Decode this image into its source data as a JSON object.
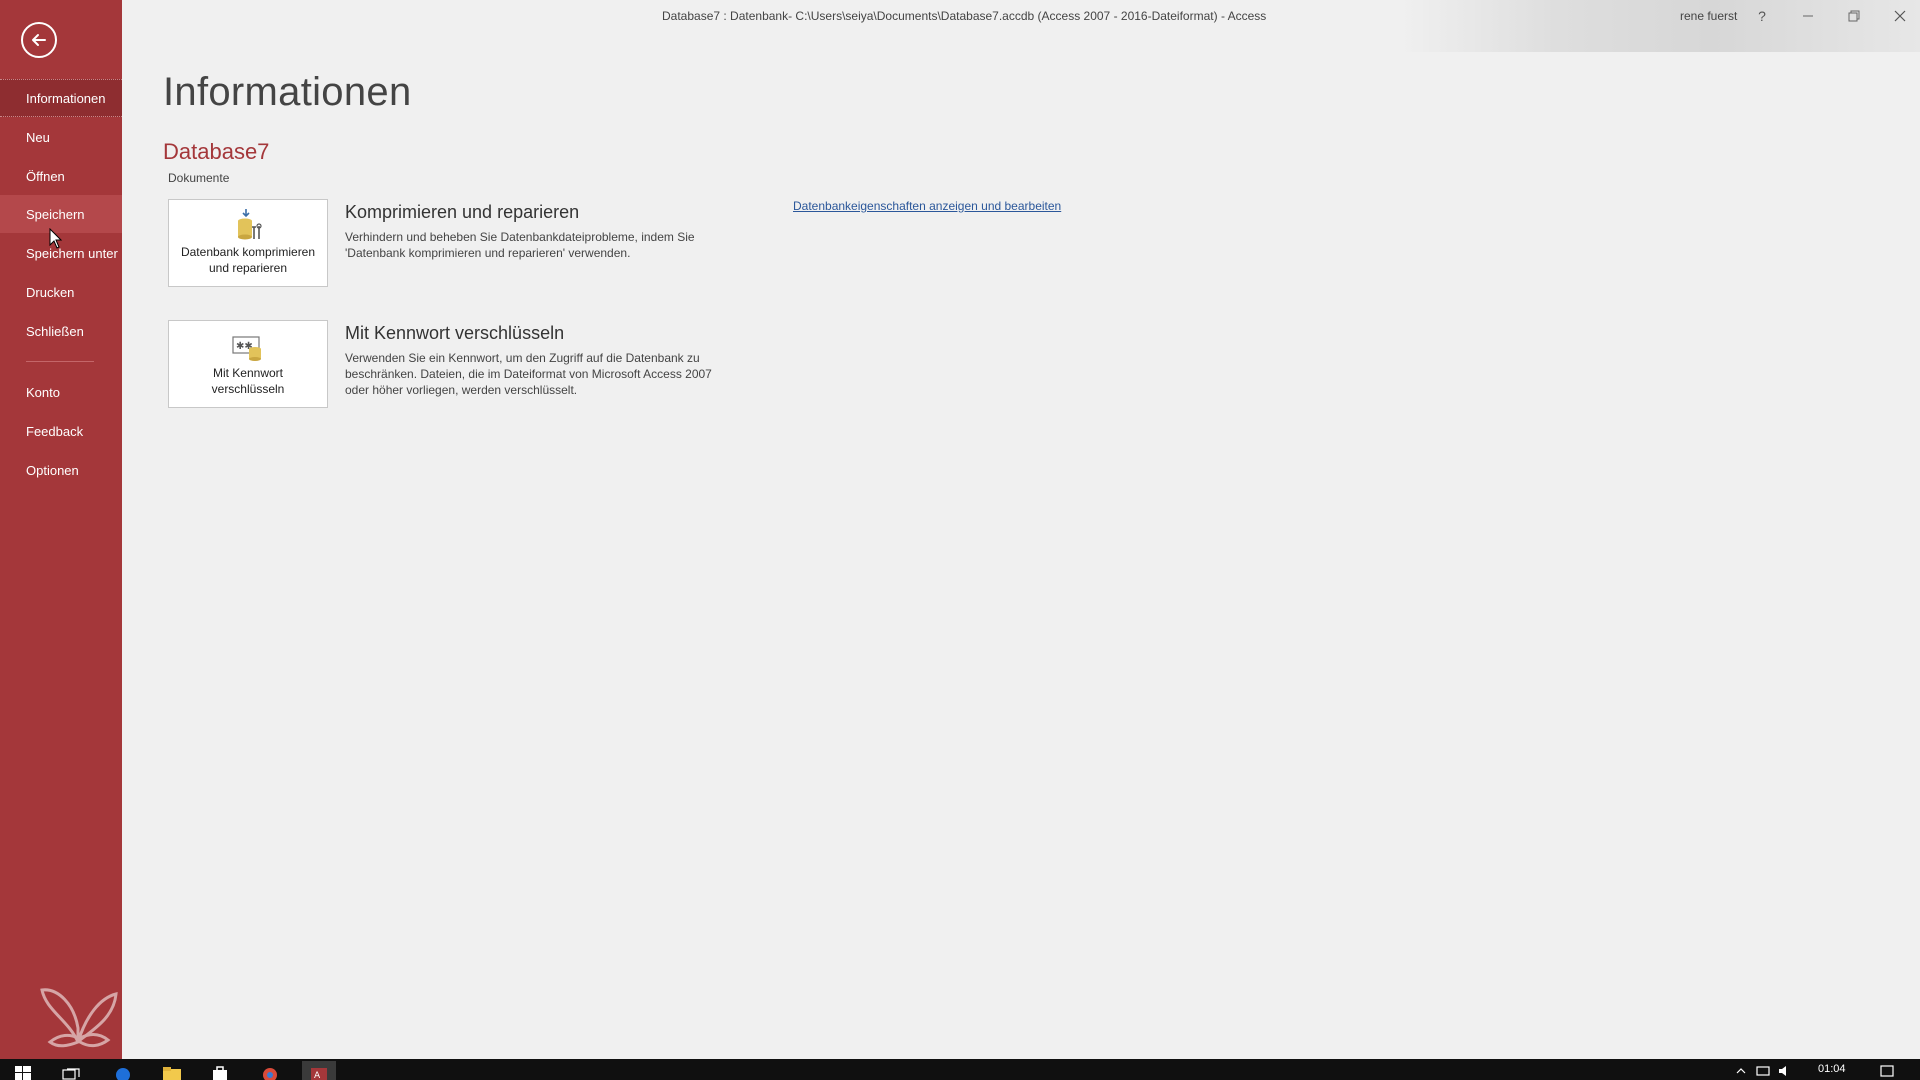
{
  "window": {
    "title": "Database7 : Datenbank- C:\\Users\\seiya\\Documents\\Database7.accdb (Access 2007 - 2016-Dateiformat)  -  Access",
    "user": "rene fuerst",
    "help_label": "?"
  },
  "sidebar": {
    "items": [
      {
        "label": "Informationen"
      },
      {
        "label": "Neu"
      },
      {
        "label": "Öffnen"
      },
      {
        "label": "Speichern"
      },
      {
        "label": "Speichern unter"
      },
      {
        "label": "Drucken"
      },
      {
        "label": "Schließen"
      },
      {
        "label": "Konto"
      },
      {
        "label": "Feedback"
      },
      {
        "label": "Optionen"
      }
    ],
    "selected": "Informationen",
    "hovered": "Speichern"
  },
  "main": {
    "title": "Informationen",
    "db_name": "Database7",
    "db_location": "Dokumente",
    "actions": [
      {
        "tile_label": "Datenbank komprimieren\nund reparieren",
        "heading": "Komprimieren und reparieren",
        "description": "Verhindern und beheben Sie Datenbankdateiprobleme, indem Sie 'Datenbank komprimieren und reparieren' verwenden.",
        "icon": "compact-repair-icon"
      },
      {
        "tile_label": "Mit Kennwort\nverschlüsseln",
        "heading": "Mit Kennwort verschlüsseln",
        "description": "Verwenden Sie ein Kennwort, um den Zugriff auf die Datenbank zu beschränken. Dateien, die im Dateiformat von Microsoft Access 2007 oder höher vorliegen, werden verschlüsselt.",
        "icon": "encrypt-password-icon"
      }
    ],
    "properties_link": "Datenbankeigenschaften anzeigen und bearbeiten"
  },
  "taskbar": {
    "time": "01:04",
    "icons": [
      "windows-start-icon",
      "task-view-icon",
      "edge-icon",
      "file-explorer-icon",
      "store-icon",
      "chrome-icon",
      "access-icon"
    ]
  },
  "colors": {
    "accent": "#a4373a",
    "link": "#2b579a",
    "background": "#f0f0f0"
  }
}
